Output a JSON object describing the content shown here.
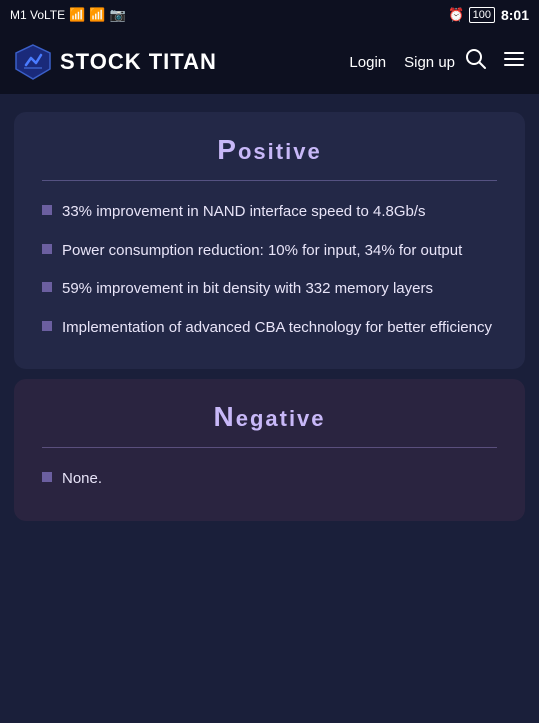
{
  "statusBar": {
    "left": "M1 VoLTE",
    "signals": "4G+ WiFi",
    "time": "8:01",
    "battery": "100"
  },
  "navbar": {
    "logoText": "STOCK TITAN",
    "loginLabel": "Login",
    "signupLabel": "Sign up"
  },
  "positiveCard": {
    "title": "Positive",
    "firstLetter": "P",
    "rest": "ositive",
    "bullets": [
      "33% improvement in NAND interface speed to 4.8Gb/s",
      "Power consumption reduction: 10% for input, 34% for output",
      "59% improvement in bit density with 332 memory layers",
      "Implementation of advanced CBA technology for better efficiency"
    ]
  },
  "negativeCard": {
    "title": "Negative",
    "firstLetter": "N",
    "rest": "egative",
    "bullets": [
      "None."
    ]
  }
}
